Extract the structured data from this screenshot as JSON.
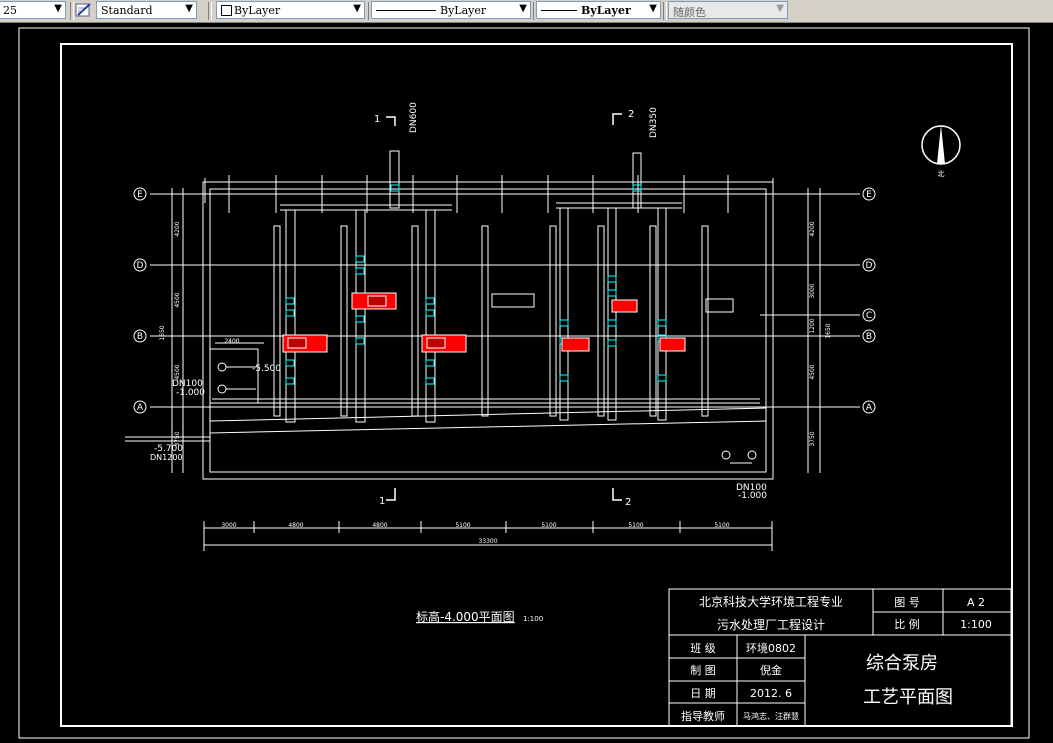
{
  "toolbar": {
    "scale_value": "25",
    "text_style": "Standard",
    "layer_color": "ByLayer",
    "linetype": "ByLayer",
    "lineweight": "ByLayer",
    "plot_style": "随颜色"
  },
  "drawing": {
    "axis_labels": [
      "E",
      "D",
      "B",
      "A",
      "C"
    ],
    "section_marks": [
      "1",
      "2",
      "1",
      "2"
    ],
    "pipe_dn_top_1": "DN600",
    "pipe_dn_top_2": "DN350",
    "dn100_left": "DN100",
    "elev_left_1": "-5.500",
    "elev_left_2": "-1.000",
    "elev_left_3": "-5.700",
    "dn1200": "DN1200",
    "dn100_right": "DN100",
    "elev_right": "-1.000",
    "dims_left": [
      "4200",
      "4500",
      "1650",
      "4500",
      "3750"
    ],
    "dims_right": [
      "4200",
      "3000",
      "1200",
      "4500",
      "3750",
      "1650"
    ],
    "dim_2400": "2400",
    "dims_bottom": [
      "3000",
      "4800",
      "4800",
      "5100",
      "5100",
      "5100",
      "5100"
    ],
    "dim_total": "33300",
    "plan_title": "标高-4.000平面图",
    "plan_scale": "1:100",
    "north_label": "北"
  },
  "title_block": {
    "school": "北京科技大学环境工程专业",
    "project": "污水处理厂工程设计",
    "label_drawing_no": "图  号",
    "drawing_no": "A 2",
    "label_scale": "比  例",
    "scale": "1:100",
    "label_class": "班  级",
    "class": "环境0802",
    "label_drafter": "制  图",
    "drafter": "倪金",
    "label_date": "日  期",
    "date": "2012. 6",
    "label_advisor": "指导教师",
    "advisor": "马鸿志、汪群慧",
    "drawing_name_1": "综合泵房",
    "drawing_name_2": "工艺平面图"
  }
}
